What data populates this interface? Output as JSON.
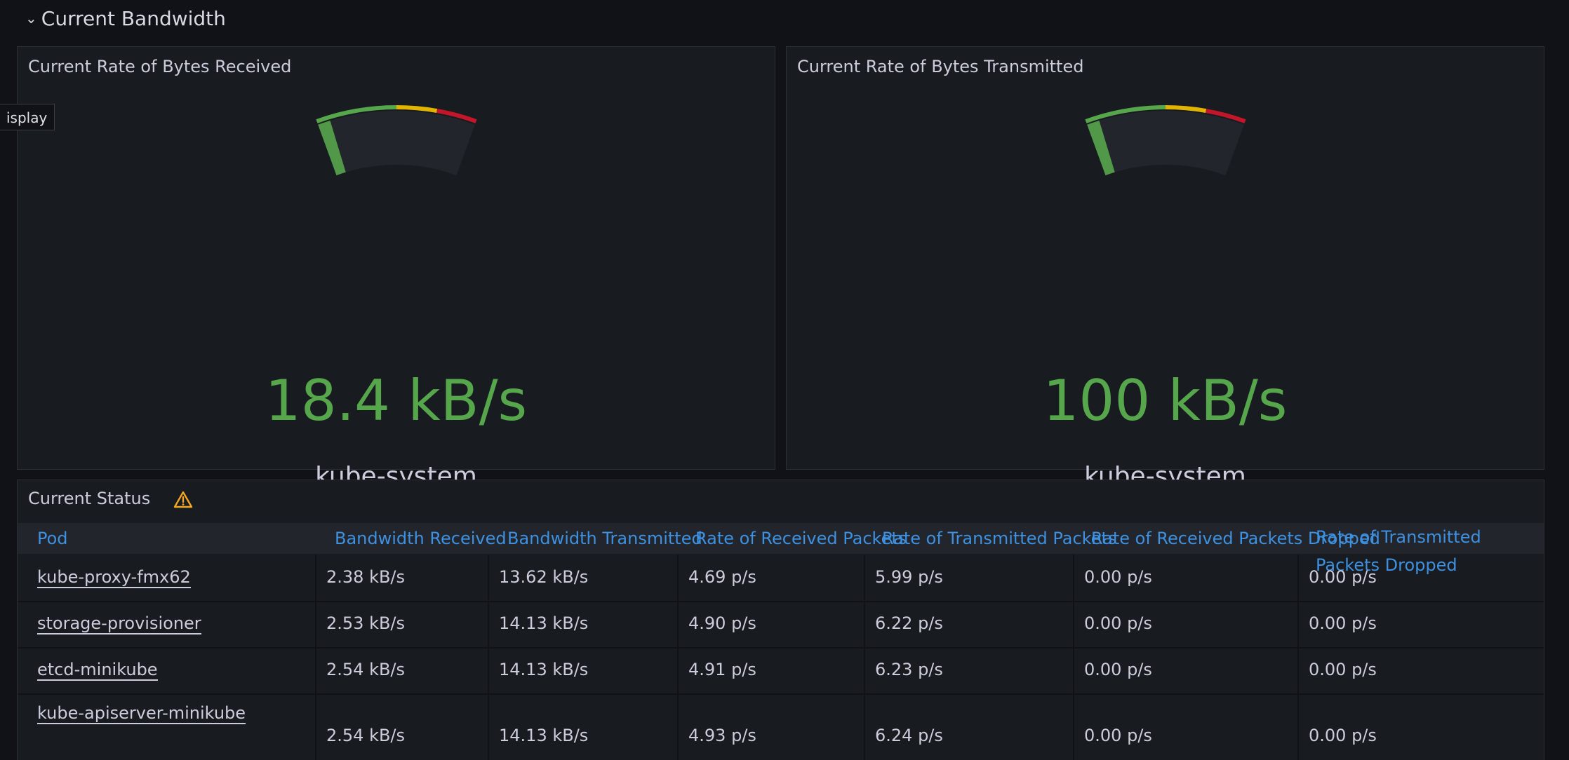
{
  "row": {
    "chevron": "⌄",
    "title": "Current Bandwidth"
  },
  "tooltip": {
    "text": "isplay"
  },
  "gauges": [
    {
      "title": "Current Rate of Bytes Received",
      "value": "18.4 kB/s",
      "label": "kube-system",
      "fraction": 0.08
    },
    {
      "title": "Current Rate of Bytes Transmitted",
      "value": "100 kB/s",
      "label": "kube-system",
      "fraction": 0.08
    }
  ],
  "thresholds": {
    "green": "#56a64b",
    "yellow": "#e0b400",
    "red": "#c4162a",
    "track": "#22252b"
  },
  "status": {
    "title": "Current Status",
    "icon": "warning-icon",
    "columns": [
      "Pod",
      "Bandwidth Received",
      "Bandwidth Transmitted",
      "Rate of Received Packets",
      "Rate of Transmitted Packets",
      "Rate of Received Packets Dropped",
      "Rate of Transmitted Packets Dropped"
    ],
    "rows": [
      [
        "kube-proxy-fmx62",
        "2.38 kB/s",
        "13.62 kB/s",
        "4.69 p/s",
        "5.99 p/s",
        "0.00 p/s",
        "0.00 p/s"
      ],
      [
        "storage-provisioner",
        "2.53 kB/s",
        "14.13 kB/s",
        "4.90 p/s",
        "6.22 p/s",
        "0.00 p/s",
        "0.00 p/s"
      ],
      [
        "etcd-minikube",
        "2.54 kB/s",
        "14.13 kB/s",
        "4.91 p/s",
        "6.23 p/s",
        "0.00 p/s",
        "0.00 p/s"
      ],
      [
        "kube-apiserver-minikube",
        "2.54 kB/s",
        "14.13 kB/s",
        "4.93 p/s",
        "6.24 p/s",
        "0.00 p/s",
        "0.00 p/s"
      ]
    ]
  }
}
